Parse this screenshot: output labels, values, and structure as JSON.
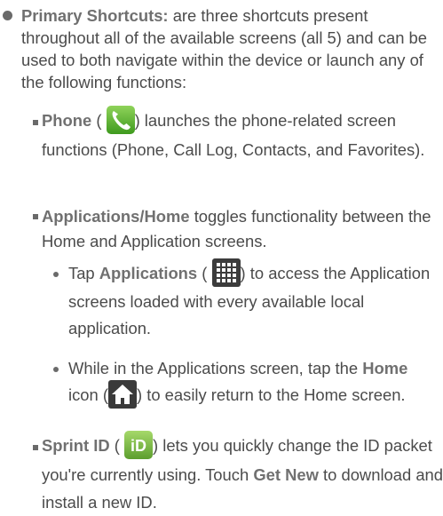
{
  "primary_shortcuts": {
    "title": "Primary Shortcuts:",
    "text": "are three shortcuts present throughout all of the available screens (all 5) and can be used to both navigate within the device or launch any of the following functions:"
  },
  "phone": {
    "label": "Phone",
    "paren_open": "(",
    "text_after": ") launches the phone-related screen functions (Phone, Call Log, Contacts, and Favorites).",
    "icon": "phone-icon",
    "icon_color": "#5db832"
  },
  "apps_home": {
    "label": "Applications/Home",
    "text": "toggles functionality between the Home and Application screens."
  },
  "tap_apps": {
    "tap": "Tap",
    "label": "Applications",
    "paren_open": "(",
    "text_after": ") to access the Application screens loaded with every available local application.",
    "icon": "apps-grid-icon"
  },
  "tap_home": {
    "text_before": "While in the Applications screen, tap the",
    "label": "Home",
    "text_mid": "icon (",
    "text_after": ") to easily return to the Home screen.",
    "icon": "home-icon"
  },
  "sprint_id": {
    "label": "Sprint ID",
    "paren_open": "(",
    "text_after": ") lets you quickly change the ID packet you're currently using. Touch",
    "label2": "Get New",
    "text_end": "to download and install a new ID.",
    "icon": "sprint-id-icon",
    "icon_color": "#8bc34a"
  }
}
